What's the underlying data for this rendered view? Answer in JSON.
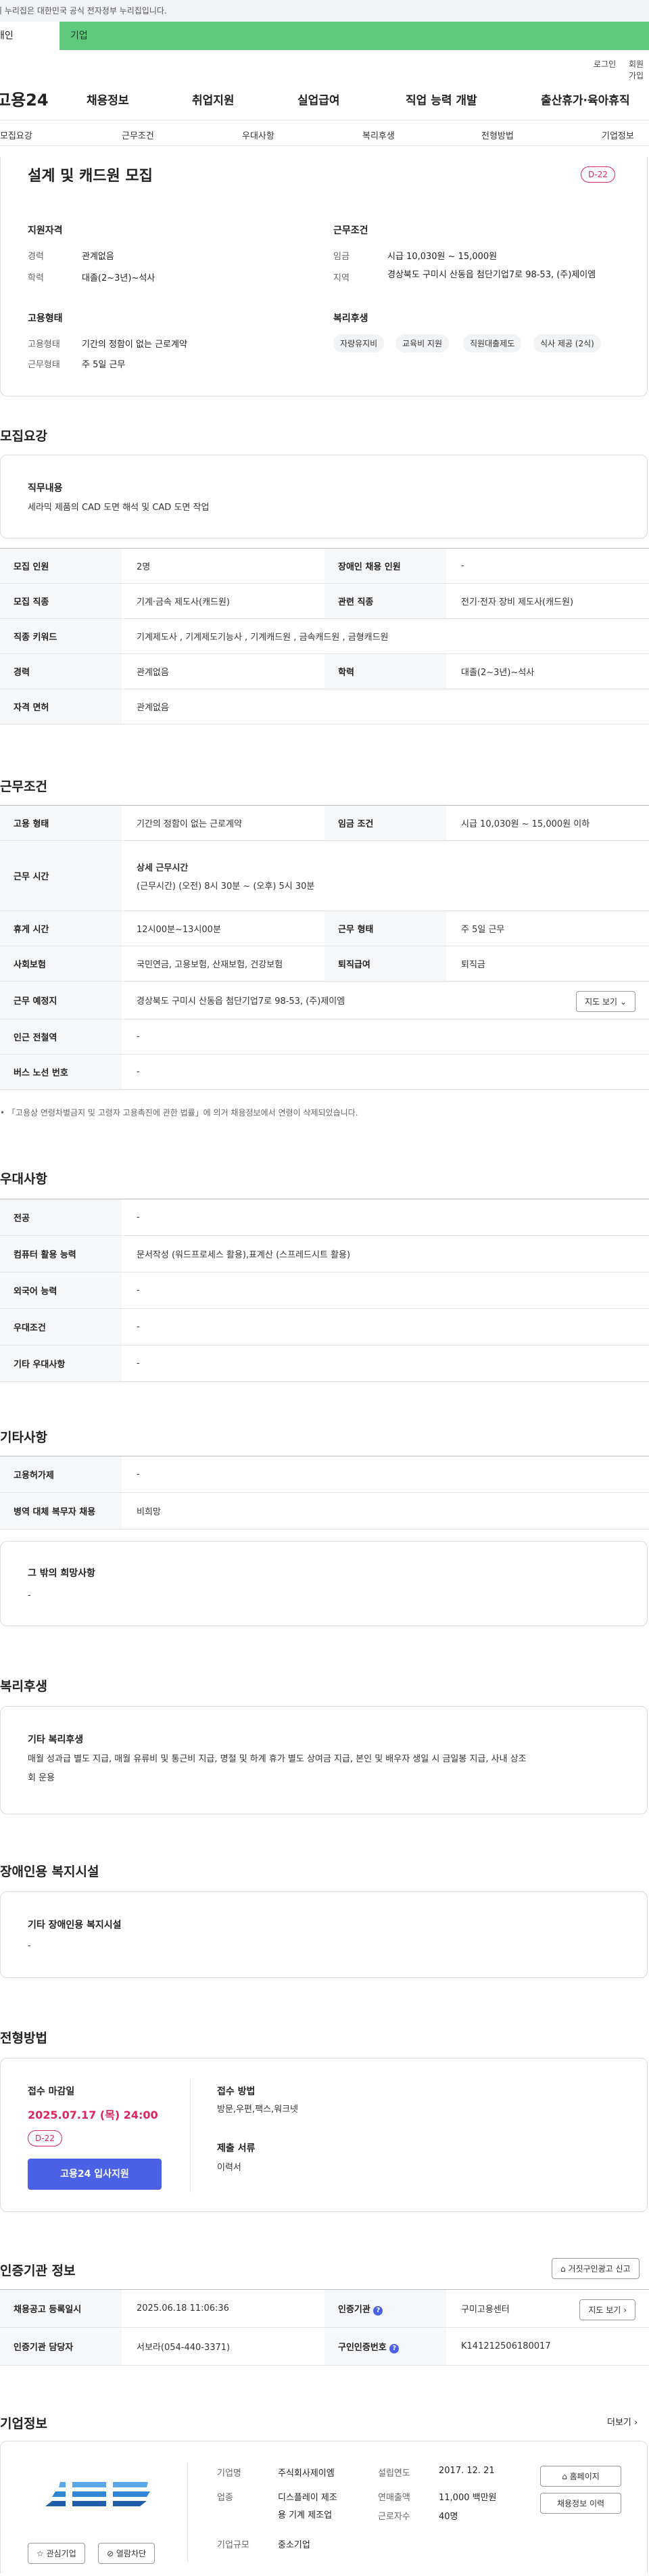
{
  "gov_banner": "이 누리집은 대한민국 공식 전자정부 누리집입니다.",
  "tabs": {
    "individual": "개인",
    "corporate": "기업"
  },
  "util": {
    "login": "로그인",
    "signup": "회원가입"
  },
  "logo": "고용24",
  "nav": [
    "채용정보",
    "취업지원",
    "실업급여",
    "직업 능력 개발",
    "출산휴가·육아휴직"
  ],
  "sub_nav": [
    "모집요강",
    "근무조건",
    "우대사항",
    "복리후생",
    "전형방법",
    "기업정보"
  ],
  "summary": {
    "title": "설계 및 캐드원 모집",
    "dday": "D-22",
    "qualification": {
      "heading": "지원자격",
      "rows": [
        {
          "k": "경력",
          "v": "관계없음"
        },
        {
          "k": "학력",
          "v": "대졸(2~3년)~석사"
        }
      ]
    },
    "conditions": {
      "heading": "근무조건",
      "rows": [
        {
          "k": "임금",
          "v": "시급 10,030원 ~ 15,000원"
        },
        {
          "k": "지역",
          "v": "경상북도 구미시 산동읍 첨단기업7로 98-53, (주)제이엠"
        }
      ]
    },
    "employment": {
      "heading": "고용형태",
      "rows": [
        {
          "k": "고용형태",
          "v": "기간의 정함이 없는 근로계약"
        },
        {
          "k": "근무형태",
          "v": "주 5일 근무"
        }
      ]
    },
    "welfare": {
      "heading": "복리후생",
      "tags": [
        "자량유지비",
        "교육비 지원",
        "직원대출제도",
        "식사 제공 (2식)"
      ]
    }
  },
  "recruit": {
    "title": "모집요강",
    "duty_heading": "직무내용",
    "duty_text": "세라믹 제품의 CAD 도면 해석 및 CAD 도면 작업",
    "rows": [
      {
        "k1": "모집 인원",
        "v1": "2명",
        "k2": "장애인 채용 인원",
        "v2": "-"
      },
      {
        "k1": "모집 직종",
        "v1": "기계·금속 제도사(캐드원)",
        "k2": "관련 직종",
        "v2": "전기·전자 장비 제도사(캐드원)"
      },
      {
        "k1": "직종 키워드",
        "v1": "기계제도사 , 기계제도기능사 , 기계캐드원 , 금속캐드원 , 금형캐드원"
      },
      {
        "k1": "경력",
        "v1": "관계없음",
        "k2": "학력",
        "v2": "대졸(2~3년)~석사"
      },
      {
        "k1": "자격 면허",
        "v1": "관계없음"
      }
    ]
  },
  "work": {
    "title": "근무조건",
    "emp_type_k": "고용 형태",
    "emp_type_v": "기간의 정함이 없는 근로계약",
    "wage_k": "임금 조건",
    "wage_v": "시급 10,030원 ~ 15,000원 이하",
    "hours_k": "근무 시간",
    "hours_h": "상세 근무시간",
    "hours_v": "(근무시간) (오전) 8시 30분 ~ (오후) 5시 30분",
    "rest_k": "휴게 시간",
    "rest_v": "12시00분~13시00분",
    "form_k": "근무 형태",
    "form_v": "주 5일 근무",
    "ins_k": "사회보험",
    "ins_v": "국민연금, 고용보험, 산재보험, 건강보험",
    "sev_k": "퇴직급여",
    "sev_v": "퇴직금",
    "place_k": "근무 예정지",
    "place_v": "경상북도 구미시 산동읍 첨단기업7로 98-53, (주)제이엠",
    "map_btn": "지도 보기",
    "subway_k": "인근 전철역",
    "subway_v": "-",
    "bus_k": "버스 노선 번호",
    "bus_v": "-",
    "note": "「고용상 연령차별금지 및 고령자 고용촉진에 관한 법률」에 의거 채용정보에서 연령이 삭제되었습니다."
  },
  "prefer": {
    "title": "우대사항",
    "rows": [
      {
        "k": "전공",
        "v": "-"
      },
      {
        "k": "컴퓨터 활용 능력",
        "v": "문서작성 (워드프로세스 활용),표계산 (스프레드시트 활용)"
      },
      {
        "k": "외국어 능력",
        "v": "-"
      },
      {
        "k": "우대조건",
        "v": "-"
      },
      {
        "k": "기타 우대사항",
        "v": "-"
      }
    ]
  },
  "etc": {
    "title": "기타사항",
    "rows": [
      {
        "k": "고용허가제",
        "v": "-"
      },
      {
        "k": "병역 대체 복무자 채용",
        "v": "비희망"
      }
    ],
    "box_h": "그 밖의 희망사항",
    "box_v": "-"
  },
  "benefit": {
    "title": "복리후생",
    "box_h": "기타 복리후생",
    "line1": "매월 성과급 별도 지급, 매월 유류비 및 통근비 지급, 명절 및 하계 휴가 별도 상여금 지급, 본인 및 배우자 생일 시 금일봉 지급, 사내 상조",
    "line2": "회 운용"
  },
  "disabled": {
    "title": "장애인용 복지시설",
    "box_h": "기타 장애인용 복지시설",
    "box_v": "-"
  },
  "selection": {
    "title": "전형방법",
    "deadline_h": "접수 마감일",
    "deadline_v": "2025.07.17 (목) 24:00",
    "dday": "D-22",
    "apply_btn": "고용24 입사지원",
    "method_h": "접수 방법",
    "method_v": "방문,우편,팩스,워크넷",
    "docs_h": "제출 서류",
    "docs_v": "이력서"
  },
  "cert": {
    "title": "인증기관 정보",
    "report_btn": "거짓구인광고 신고",
    "reg_k": "채용공고 등록일시",
    "reg_v": "2025.06.18 11:06:36",
    "org_k": "인증기관",
    "org_v": "구미고용센터",
    "map_btn": "지도 보기",
    "mgr_k": "인증기관 담당자",
    "mgr_v": "서보라(054-440-3371)",
    "no_k": "구인인증번호",
    "no_v": "K141212506180017"
  },
  "company": {
    "title": "기업정보",
    "more": "더보기",
    "interest_btn": "관심기업",
    "block_btn": "열람차단",
    "rows": [
      {
        "k": "기업명",
        "v": "주식회사제이엠",
        "k2": "설립연도",
        "v2": "2017. 12. 21"
      },
      {
        "k": "업종",
        "v": "디스플레이 제조",
        "v_b": "용 기계 제조업",
        "k2": "연매출액",
        "v2": "11,000 백만원",
        "k3": "근로자수",
        "v3": "40명"
      },
      {
        "k": "기업규모",
        "v": "중소기업"
      }
    ],
    "home_btn": "홈페이지",
    "jobs_btn": "채용정보 이력"
  },
  "colors": {
    "green": "#5ec87b",
    "accent": "#e0245e",
    "blue": "#4b62e6"
  }
}
